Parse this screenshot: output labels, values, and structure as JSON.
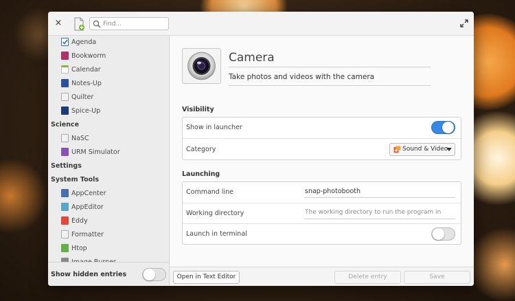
{
  "titlebar": {
    "close_label": "×",
    "search_placeholder": "Find..."
  },
  "sidebar": {
    "items": [
      {
        "type": "item",
        "label": "Agenda",
        "icon": "agenda-icon",
        "color": "#2f6fc0"
      },
      {
        "type": "item",
        "label": "Bookworm",
        "icon": "bookworm-icon",
        "color": "#b0306a"
      },
      {
        "type": "item",
        "label": "Calendar",
        "icon": "calendar-icon",
        "color": "#7aba3c"
      },
      {
        "type": "item",
        "label": "Notes-Up",
        "icon": "notes-up-icon",
        "color": "#2d4f9c"
      },
      {
        "type": "item",
        "label": "Quilter",
        "icon": "quilter-icon",
        "color": "#bdbdbd"
      },
      {
        "type": "item",
        "label": "Spice-Up",
        "icon": "spice-up-icon",
        "color": "#1f3a78"
      },
      {
        "type": "category",
        "label": "Science"
      },
      {
        "type": "item",
        "label": "NaSC",
        "icon": "nasc-icon",
        "color": "#c9c9c9"
      },
      {
        "type": "item",
        "label": "URM Simulator",
        "icon": "urm-simulator-icon",
        "color": "#8a4fb8"
      },
      {
        "type": "category",
        "label": "Settings"
      },
      {
        "type": "category",
        "label": "System Tools"
      },
      {
        "type": "item",
        "label": "AppCenter",
        "icon": "appcenter-icon",
        "color": "#4a6fb0"
      },
      {
        "type": "item",
        "label": "AppEditor",
        "icon": "appeditor-icon",
        "color": "#5aa6c9"
      },
      {
        "type": "item",
        "label": "Eddy",
        "icon": "eddy-icon",
        "color": "#e4473a"
      },
      {
        "type": "item",
        "label": "Formatter",
        "icon": "formatter-icon",
        "color": "#9a9a9a"
      },
      {
        "type": "item",
        "label": "Htop",
        "icon": "htop-icon",
        "color": "#63b04a"
      },
      {
        "type": "item",
        "label": "Image Burner",
        "icon": "image-burner-icon",
        "color": "#8a8a8a"
      }
    ],
    "footer": {
      "label": "Show hidden entries",
      "toggle_on": false
    }
  },
  "app": {
    "name": "Camera",
    "comment": "Take photos and videos with the camera",
    "icon": "camera-icon"
  },
  "visibility": {
    "title": "Visibility",
    "show_in_launcher": {
      "label": "Show in launcher",
      "on": true
    },
    "category": {
      "label": "Category",
      "value": "Sound & Video",
      "icon": "sound-video-icon"
    }
  },
  "launching": {
    "title": "Launching",
    "command_line": {
      "label": "Command line",
      "value": "snap-photobooth"
    },
    "working_directory": {
      "label": "Working directory",
      "placeholder": "The working directory to run the program in"
    },
    "launch_in_terminal": {
      "label": "Launch in terminal",
      "on": false
    }
  },
  "footer": {
    "open_in_text_editor": "Open in Text Editor",
    "delete_entry": "Delete entry",
    "save": "Save"
  },
  "colors": {
    "accent": "#3689e6"
  }
}
